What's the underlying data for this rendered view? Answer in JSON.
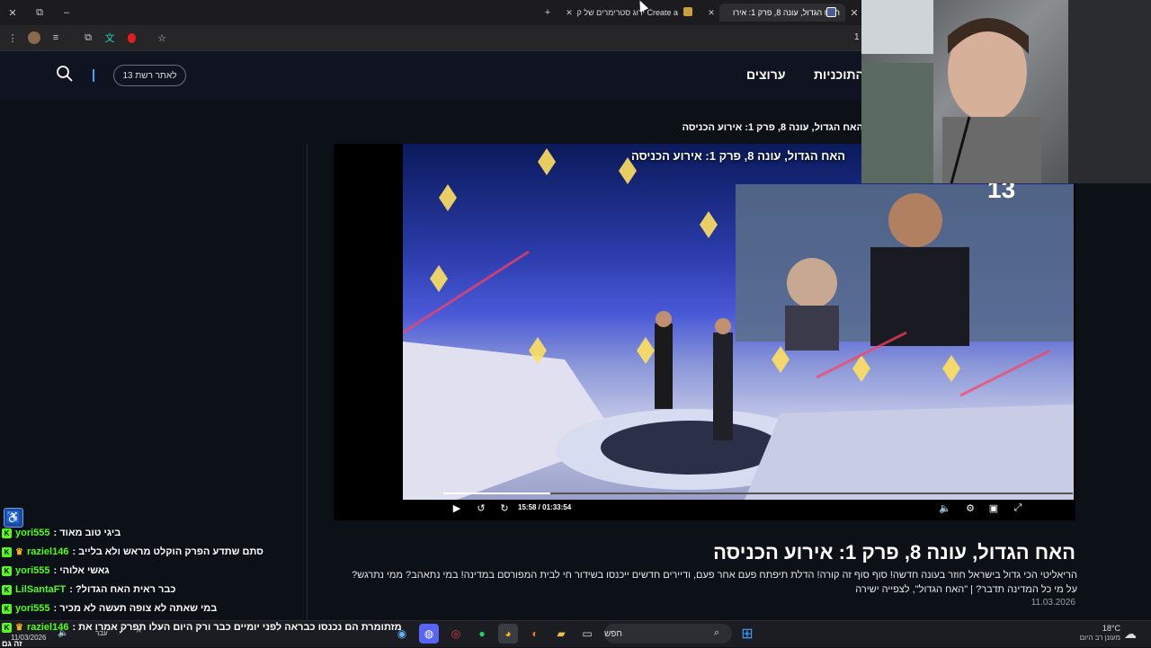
{
  "browser": {
    "tabs": [
      {
        "label": "האח הגדול, עונה 8, פרק 1: אירו"
      },
      {
        "label": "Create a ירוג סטרימרים של קיק"
      }
    ],
    "new_tab_symbol": "+",
    "close_symbol": "✕",
    "minimize_symbol": "–",
    "restore_symbol": "⧉",
    "toolbar_edge_text": "1"
  },
  "site": {
    "nav": [
      "התוכניות",
      "ערוצים"
    ],
    "site_button_label": "לאתר רשת 13",
    "breadcrumb": "האח הגדול, עונה 8, פרק 1: אירוע הכניסה"
  },
  "player": {
    "title": "האח הגדול, עונה 8, פרק 1: אירוע הכניסה",
    "time": "15:58 / 01:33:54",
    "progress": 0.17,
    "channel_logo": "13"
  },
  "episode": {
    "title": "האח הגדול, עונה 8, פרק 1: אירוע הכניסה",
    "description": "הריאליטי הכי גדול בישראל חוזר בעונה חדשה! סוף סוף זה קורה! הדלת תיפתח פעם אחר פעם, ודיירים חדשים ייכנסו בשידור חי לבית המפורסם במדינה! במי נתאהב? ממי נתרגש? על מי כל המדינה תדבר? | \"האח הגדול\", לצפייה ישירה",
    "date": "11.03.2026"
  },
  "chat": [
    {
      "user": "yori555",
      "message": "ביגי טוב מאוד :",
      "badge": ""
    },
    {
      "user": "raziel146",
      "message": "סתם שתדע הפרק הוקלט מראש ולא בלייב :",
      "badge": "crown"
    },
    {
      "user": "yori555",
      "message": "גאשי אלוהי :",
      "badge": ""
    },
    {
      "user": "LilSantaFT",
      "message": "כבר ראית האח הגדול? :",
      "badge": ""
    },
    {
      "user": "yori555",
      "message": "במי שאתה לא צופה תעשה לא מכיר :",
      "badge": ""
    },
    {
      "user": "raziel146",
      "message": "מזתומרת הם נכנסו כבראה לפני יומיים כבר ורק היום העלו תפרק אמרו את :",
      "badge": "crown"
    }
  ],
  "chat_overflow_text": "זה גם",
  "taskbar": {
    "date": "11/03/2026",
    "search_placeholder": "חפש",
    "weather_temp": "18°C",
    "weather_desc": "מעונן רב היום",
    "lang": "עבר"
  },
  "colors": {
    "kick_green": "#53fc18",
    "page_bg": "#0c1017",
    "header_bg": "#0f1420"
  }
}
